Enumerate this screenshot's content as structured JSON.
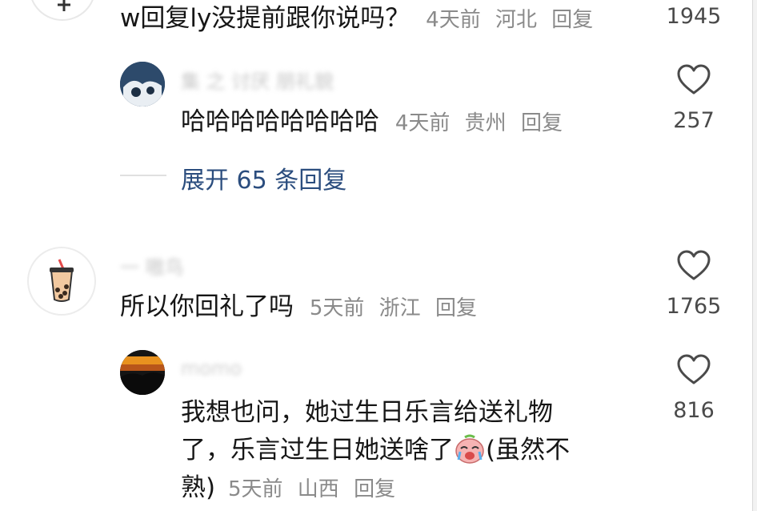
{
  "comments": [
    {
      "id": "c1",
      "text": "w回复ly没提前跟你说吗？",
      "time": "4天前",
      "location": "河北",
      "reply_label": "回复",
      "likes": "1945"
    },
    {
      "id": "c1r1",
      "username": "集 之 讨厌 朋礼貌",
      "text": "哈哈哈哈哈哈哈哈",
      "time": "4天前",
      "location": "贵州",
      "reply_label": "回复",
      "likes": "257"
    },
    {
      "id": "c2",
      "username": "一 嗷鸟",
      "text": "所以你回礼了吗",
      "time": "5天前",
      "location": "浙江",
      "reply_label": "回复",
      "likes": "1765"
    },
    {
      "id": "c2r1",
      "username": "momo",
      "text_line1": "我想也问，她过生日乐言给送礼物",
      "text_line2": "了，乐言过生日她送啥了",
      "text_line2b": "(虽然不",
      "text_line3": "熟)",
      "time": "5天前",
      "location": "山西",
      "reply_label": "回复",
      "likes": "816"
    }
  ],
  "expand": {
    "label": "展开 65 条回复"
  },
  "colors": {
    "meta": "#8a8a8a",
    "expand": "#2b4d7e",
    "text": "#161616"
  }
}
